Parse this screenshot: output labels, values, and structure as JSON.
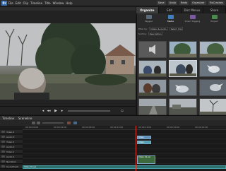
{
  "app": {
    "logo": "Pr"
  },
  "menu": [
    "File",
    "Edit",
    "Clip",
    "Timeline",
    "Title",
    "Window",
    "Help"
  ],
  "top_right": {
    "save": "Save",
    "undo": "Undo",
    "redo": "Redo",
    "organizer": "Organizer",
    "fix": "FixCrashes"
  },
  "right_panel": {
    "tabs": [
      "Organize",
      "Edit",
      "Disc Menus",
      "Share"
    ],
    "active_tab": "Organize",
    "subtabs": [
      {
        "label": "Tagged",
        "color": "#5a6a7a"
      },
      {
        "label": "Media",
        "color": "#3f7fbf"
      },
      {
        "label": "Smart Tagging",
        "color": "#7a5aa0"
      },
      {
        "label": "Project",
        "color": "#4a8a4a"
      }
    ],
    "filters": {
      "filter_by_label": "Filter by:",
      "filter_value": "Videos & Audio",
      "show_label": "Select Clip",
      "sort_label": "Sort by:",
      "sort_value": "Description"
    },
    "thumbnails": [
      {
        "kind": "audio-icon",
        "selected": false
      },
      {
        "kind": "trees",
        "selected": false
      },
      {
        "kind": "trees",
        "selected": false
      },
      {
        "kind": "people",
        "selected": false
      },
      {
        "kind": "people",
        "selected": true
      },
      {
        "kind": "bird",
        "selected": false
      },
      {
        "kind": "people",
        "selected": false
      },
      {
        "kind": "bird",
        "selected": false
      },
      {
        "kind": "bird",
        "selected": false
      },
      {
        "kind": "road",
        "selected": false
      },
      {
        "kind": "road",
        "selected": false
      },
      {
        "kind": "tree",
        "selected": false
      }
    ]
  },
  "timeline": {
    "tabs": [
      "Timeline",
      "Sceneline"
    ],
    "ruler_labels": [
      "00:00:00:00",
      "00:00:04:00",
      "00:00:08:00",
      "00:00:12:00",
      "00:00:16:00",
      "00:00:20:00",
      "00:00:24:00"
    ],
    "tracks": [
      {
        "label": "Video 3",
        "type": "video"
      },
      {
        "label": "Audio 3",
        "type": "audio"
      },
      {
        "label": "Video 2",
        "type": "video"
      },
      {
        "label": "Audio 2",
        "type": "audio"
      },
      {
        "label": "Video 1",
        "type": "video"
      },
      {
        "label": "Audio 1",
        "type": "audio"
      },
      {
        "label": "Narration",
        "type": "audio"
      },
      {
        "label": "Soundtrack",
        "type": "audio"
      }
    ],
    "clips": [
      {
        "label": "Video 01.avi",
        "color": "#5d8fb8"
      },
      {
        "label": "Video 01.avi",
        "color": "#4fa0b0"
      },
      {
        "label": "Video 01.avi",
        "color": "#6a8bb0"
      },
      {
        "label": "Video 01.avi",
        "color": "#4aa0a0"
      }
    ]
  },
  "colors": {
    "accent": "#3f7fbf",
    "playhead": "#e04030"
  }
}
